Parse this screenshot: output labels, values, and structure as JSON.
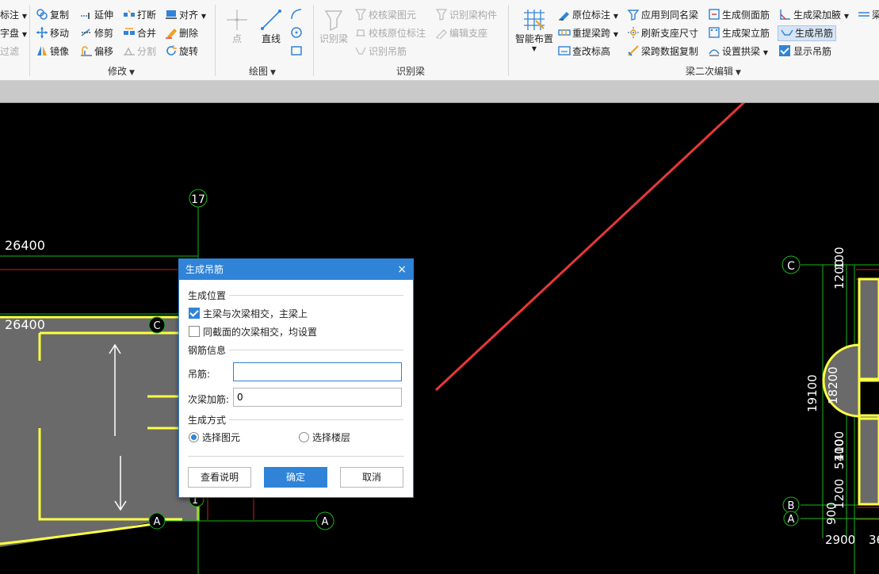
{
  "ribbon": {
    "edge_items": [
      "标注",
      "字盘",
      "过滤"
    ],
    "modify": {
      "title": "修改",
      "col1": [
        "复制",
        "移动",
        "镜像"
      ],
      "col2": [
        "延伸",
        "修剪",
        "偏移"
      ],
      "col3": [
        "打断",
        "合并",
        "分割"
      ],
      "col4": [
        "对齐",
        "删除",
        "旋转"
      ]
    },
    "draw": {
      "title": "绘图",
      "point": "点",
      "line": "直线"
    },
    "identify": {
      "title": "识别梁",
      "big": "识别梁",
      "col1": [
        "校核梁图元",
        "校核原位标注",
        "识别吊筋"
      ],
      "col2": [
        "识别梁构件",
        "编辑支座"
      ]
    },
    "secondary": {
      "title": "梁二次编辑",
      "smart": "智能布置",
      "col1": [
        "原位标注",
        "重提梁跨",
        "查改标高"
      ],
      "col2": [
        "应用到同名梁",
        "刷新支座尺寸",
        "梁跨数据复制"
      ],
      "col3": [
        "生成侧面筋",
        "生成架立筋",
        "设置拱梁"
      ],
      "col4": [
        "生成梁加腋",
        "生成吊筋",
        "显示吊筋"
      ],
      "edge": "梁"
    }
  },
  "canvas": {
    "dims": [
      "26400",
      "26400",
      "1200",
      "100",
      "19100",
      "18200",
      "5100",
      "4100",
      "1200",
      "900",
      "2900",
      "36"
    ],
    "axes": [
      "17",
      "C",
      "A",
      "A",
      "1",
      "C",
      "B",
      "A"
    ]
  },
  "dialog": {
    "title": "生成吊筋",
    "close": "×",
    "sec_position": "生成位置",
    "opt1": "主梁与次梁相交，主梁上",
    "opt1_checked": true,
    "opt2": "同截面的次梁相交，均设置",
    "opt2_checked": false,
    "sec_rebar": "钢筋信息",
    "hanger_label": "吊筋:",
    "hanger_value": "",
    "secondary_label": "次梁加筋:",
    "secondary_value": "0",
    "sec_method": "生成方式",
    "radio1": "选择图元",
    "radio2": "选择楼层",
    "btn_help": "查看说明",
    "btn_ok": "确定",
    "btn_cancel": "取消"
  },
  "colors": {
    "accent": "#2f84d8",
    "annotation": "#e63838",
    "beam": "#ffff44",
    "grid": "#18b818"
  }
}
